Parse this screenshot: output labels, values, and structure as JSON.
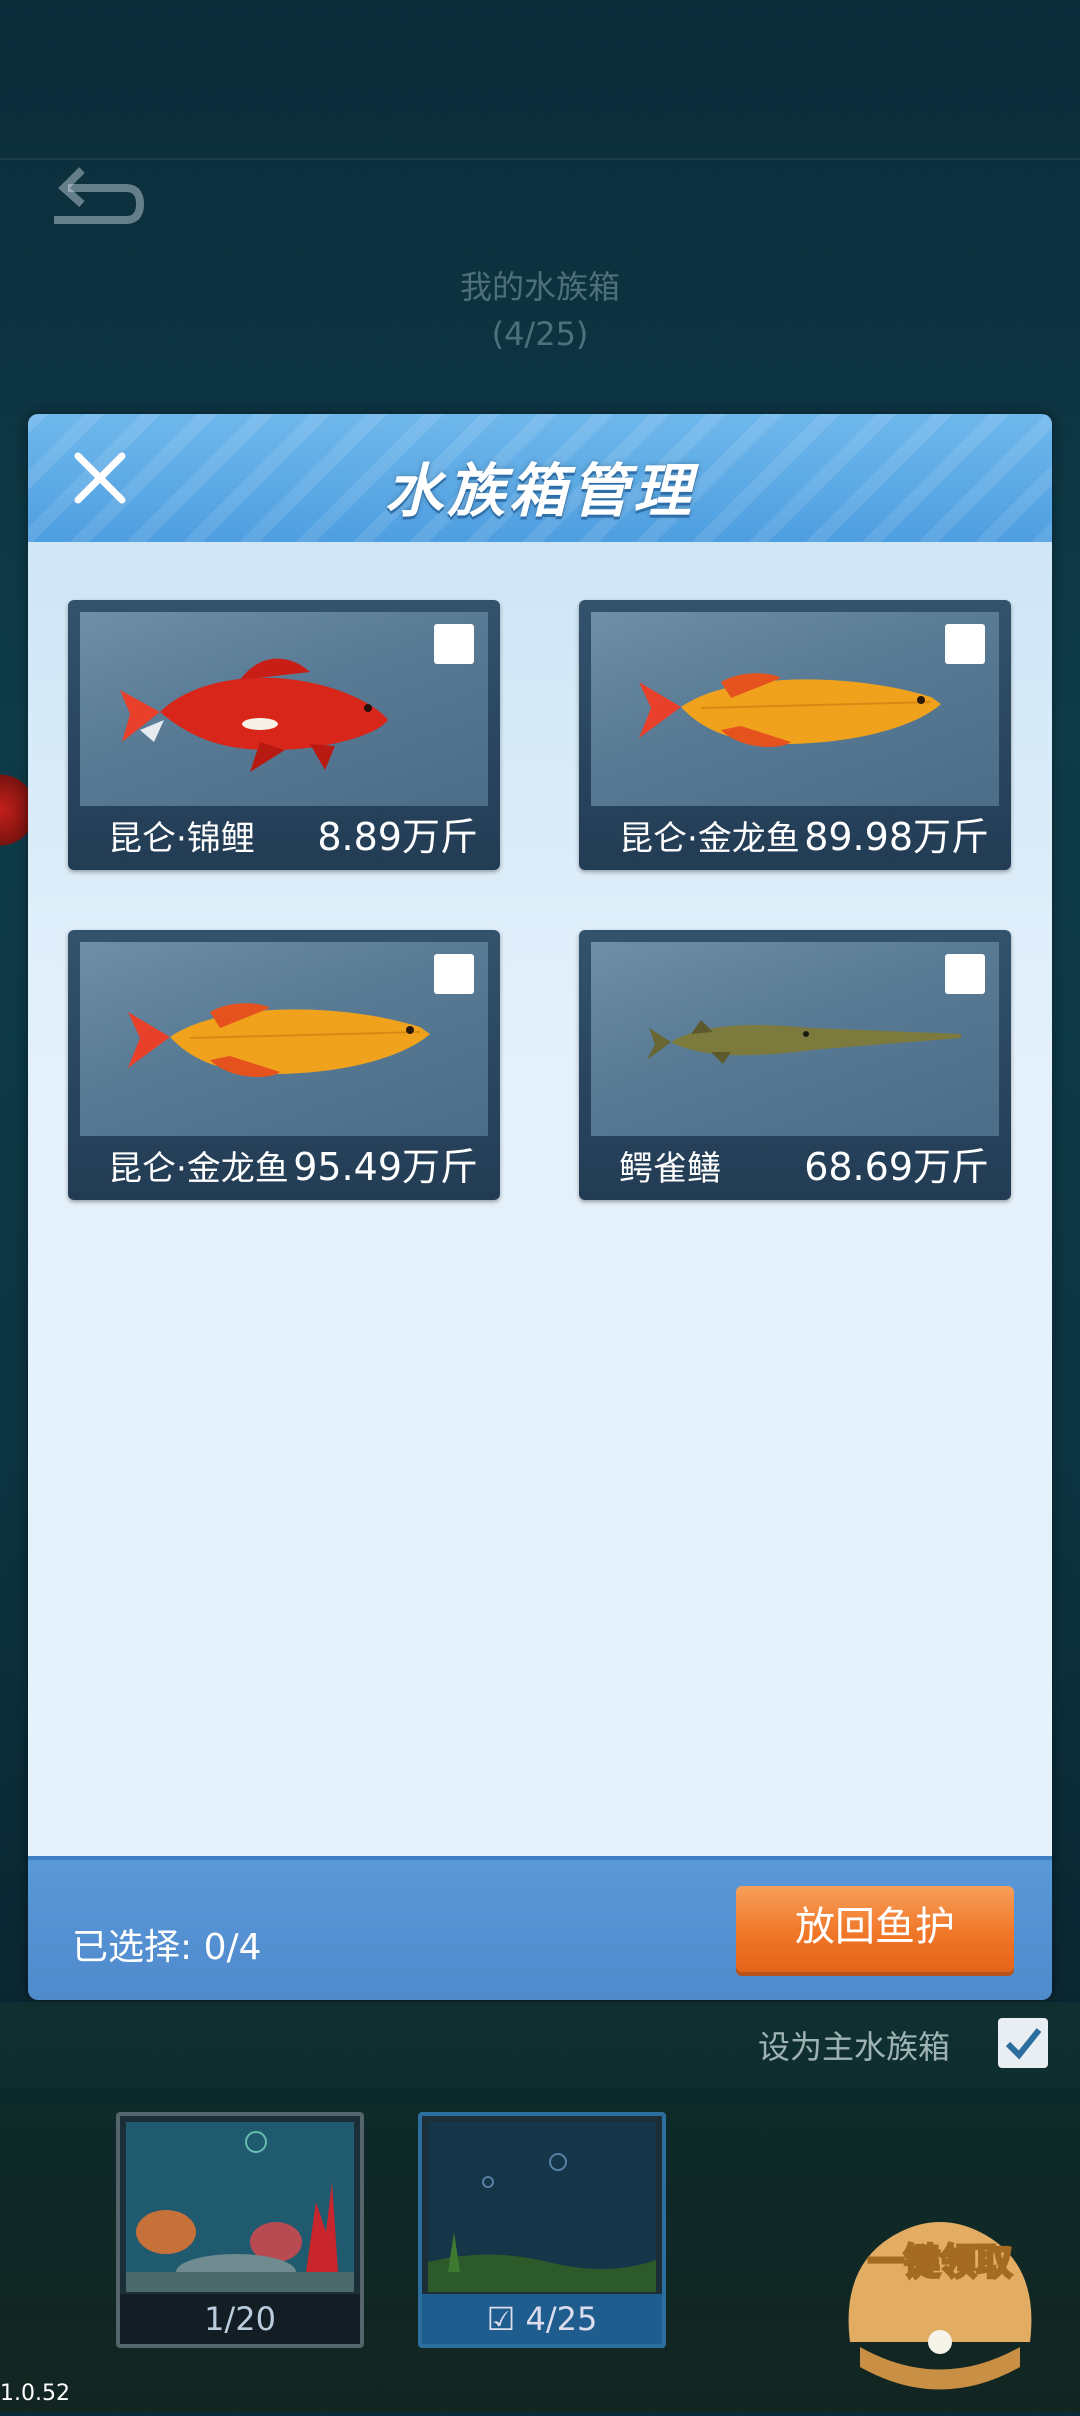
{
  "background": {
    "title": "我的水族箱",
    "count": "(4/25)"
  },
  "modal": {
    "title": "水族箱管理",
    "fish": [
      {
        "name": "昆仑·锦鲤",
        "weight": "8.89万斤",
        "kind": "koi"
      },
      {
        "name": "昆仑·金龙鱼",
        "weight": "89.98万斤",
        "kind": "arowana"
      },
      {
        "name": "昆仑·金龙鱼",
        "weight": "95.49万斤",
        "kind": "arowana"
      },
      {
        "name": "鳄雀鳝",
        "weight": "68.69万斤",
        "kind": "gar"
      }
    ],
    "selected_label": "已选择: 0/4",
    "return_button": "放回鱼护"
  },
  "set_main": {
    "label": "设为主水族箱",
    "checked": true
  },
  "tanks": [
    {
      "label": "1/20"
    },
    {
      "label": "4/25",
      "selected": true
    }
  ],
  "claim_button": "一键领取",
  "version": "1.0.52",
  "colors": {
    "accent": "#4e9ee0",
    "button": "#f07628",
    "koi": "#d8261a",
    "gold": "#f0a21c"
  }
}
